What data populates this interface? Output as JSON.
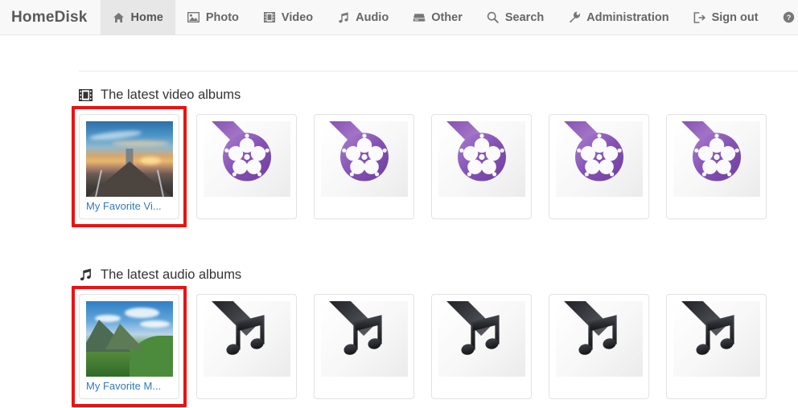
{
  "brand": {
    "label": "HomeDisk"
  },
  "nav": {
    "items": [
      {
        "label": "Home",
        "icon": "home-icon",
        "active": true
      },
      {
        "label": "Photo",
        "icon": "photo-icon",
        "active": false
      },
      {
        "label": "Video",
        "icon": "film-icon",
        "active": false
      },
      {
        "label": "Audio",
        "icon": "music-note-icon",
        "active": false
      },
      {
        "label": "Other",
        "icon": "hard-drive-icon",
        "active": false
      },
      {
        "label": "Search",
        "icon": "search-icon",
        "active": false
      },
      {
        "label": "Administration",
        "icon": "wrench-icon",
        "active": false
      },
      {
        "label": "Sign out",
        "icon": "sign-out-icon",
        "active": false
      },
      {
        "label": "Help",
        "icon": "question-circle-icon",
        "active": false
      }
    ]
  },
  "sections": [
    {
      "id": "video",
      "title": "The latest video albums",
      "icon": "film-icon",
      "cards": [
        {
          "caption": "My Favorite Vi...",
          "thumb": "pier-sunset-photo",
          "highlighted": true
        },
        {
          "caption": "",
          "thumb": "video-placeholder-icon",
          "highlighted": false
        },
        {
          "caption": "",
          "thumb": "video-placeholder-icon",
          "highlighted": false
        },
        {
          "caption": "",
          "thumb": "video-placeholder-icon",
          "highlighted": false
        },
        {
          "caption": "",
          "thumb": "video-placeholder-icon",
          "highlighted": false
        },
        {
          "caption": "",
          "thumb": "video-placeholder-icon",
          "highlighted": false
        }
      ]
    },
    {
      "id": "audio",
      "title": "The latest audio albums",
      "icon": "music-note-icon",
      "cards": [
        {
          "caption": "My Favorite M...",
          "thumb": "mountain-fjord-photo",
          "highlighted": true
        },
        {
          "caption": "",
          "thumb": "audio-placeholder-icon",
          "highlighted": false
        },
        {
          "caption": "",
          "thumb": "audio-placeholder-icon",
          "highlighted": false
        },
        {
          "caption": "",
          "thumb": "audio-placeholder-icon",
          "highlighted": false
        },
        {
          "caption": "",
          "thumb": "audio-placeholder-icon",
          "highlighted": false
        },
        {
          "caption": "",
          "thumb": "audio-placeholder-icon",
          "highlighted": false
        }
      ]
    }
  ],
  "colors": {
    "navbar_bg": "#f8f8f8",
    "active_tab_bg": "#e7e7e7",
    "link": "#337ab7",
    "highlight_box": "#ee1111",
    "video_accent": "#8b57b5",
    "audio_accent": "#2b2d31"
  }
}
